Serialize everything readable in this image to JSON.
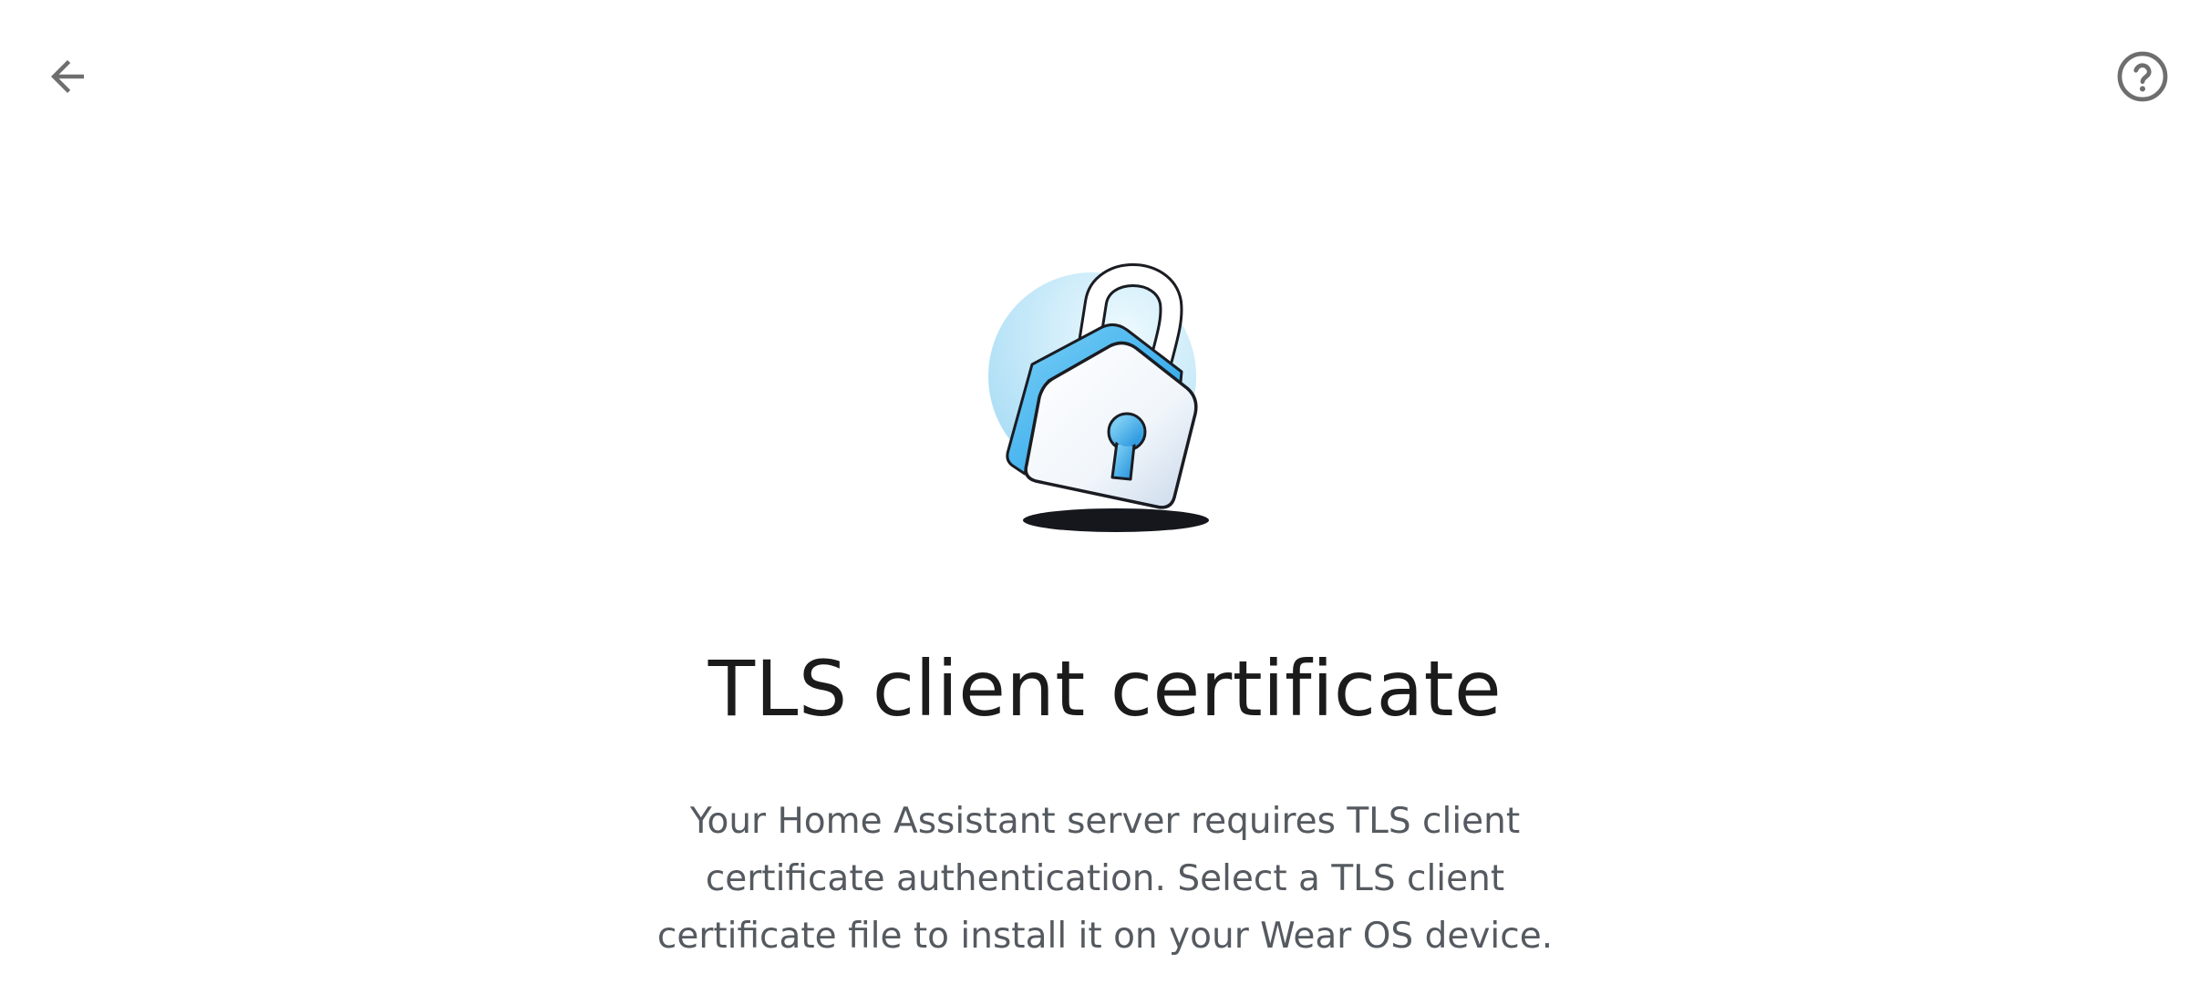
{
  "header": {
    "back_icon": "arrow-left-icon",
    "help_icon": "help-circle-icon"
  },
  "illustration": {
    "icon": "padlock-illustration",
    "colors": {
      "accent_blue": "#2aa8f0",
      "light_blue": "#cdeefa",
      "outline": "#1a1c22"
    }
  },
  "content": {
    "title": "TLS client certificate",
    "description": "Your Home Assistant server requires TLS client certificate authentication. Select a TLS client certificate file to install it on your Wear OS device."
  },
  "colors": {
    "background": "#ffffff",
    "icon_gray": "#6e6e6e",
    "title_text": "#1b1b1b",
    "body_text": "#555a60"
  }
}
